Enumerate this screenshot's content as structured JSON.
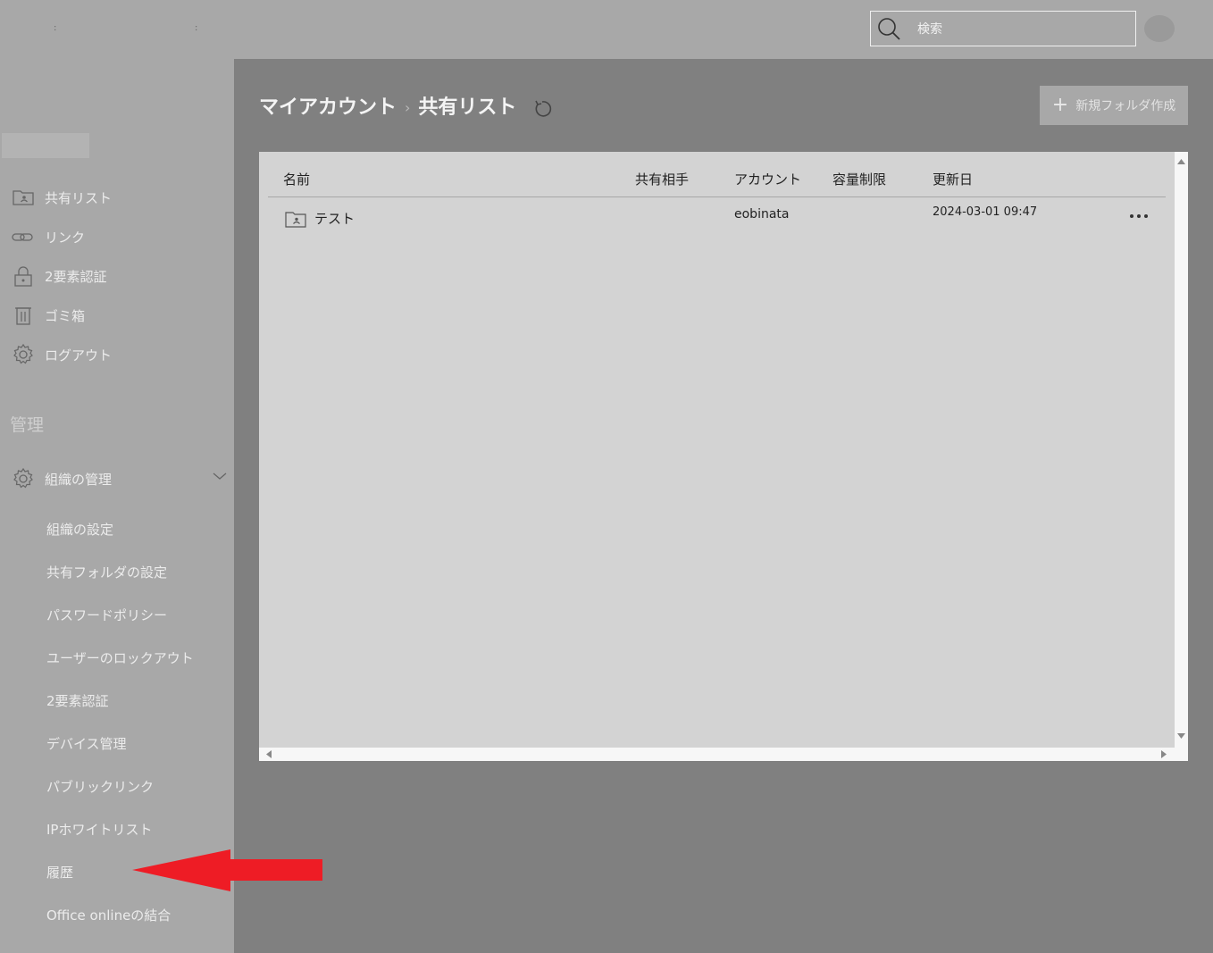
{
  "search": {
    "placeholder": "検索"
  },
  "sidebar": {
    "items": [
      {
        "label": "共有リスト",
        "icon": "shared-folder-icon"
      },
      {
        "label": "リンク",
        "icon": "link-icon"
      },
      {
        "label": "2要素認証",
        "icon": "lock-icon"
      },
      {
        "label": "ゴミ箱",
        "icon": "trash-icon"
      },
      {
        "label": "ログアウト",
        "icon": "gear-icon"
      }
    ],
    "section_title": "管理",
    "org_group": {
      "label": "組織の管理",
      "icon": "gear-icon",
      "expanded": true
    },
    "sub_items": [
      "組織の設定",
      "共有フォルダの設定",
      "パスワードポリシー",
      "ユーザーのロックアウト",
      "2要素認証",
      "デバイス管理",
      "パブリックリンク",
      "IPホワイトリスト",
      "履歴",
      "Office onlineの結合"
    ]
  },
  "breadcrumb": {
    "root": "マイアカウント",
    "separator": "›",
    "current": "共有リスト"
  },
  "toolbar": {
    "new_folder_label": "新規フォルダ作成"
  },
  "table": {
    "headers": {
      "name": "名前",
      "shared_with": "共有相手",
      "account": "アカウント",
      "quota": "容量制限",
      "updated": "更新日"
    },
    "rows": [
      {
        "name": "テスト",
        "shared_with": "",
        "account": "eobinata",
        "quota": "",
        "updated": "2024-03-01 09:47"
      }
    ]
  },
  "annotation": {
    "color": "#ee1c25",
    "points_to": "履歴"
  }
}
